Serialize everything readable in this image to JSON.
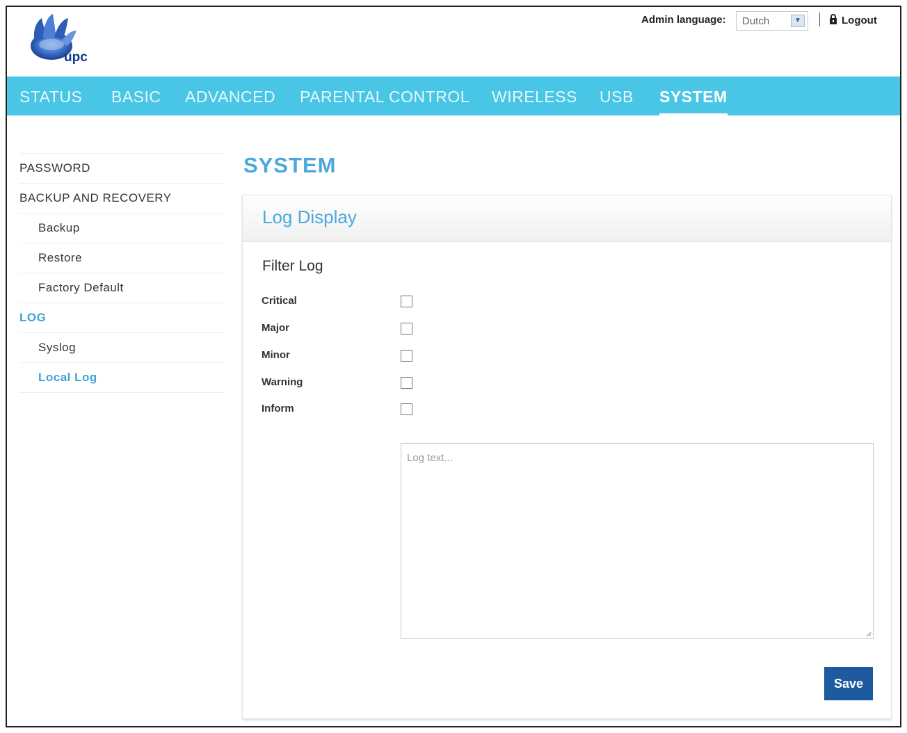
{
  "header": {
    "logo_text": "upc",
    "admin_language_label": "Admin language:",
    "language_value": "Dutch",
    "logout_label": "Logout"
  },
  "nav": {
    "items": [
      {
        "label": "STATUS",
        "active": false
      },
      {
        "label": "BASIC",
        "active": false
      },
      {
        "label": "ADVANCED",
        "active": false
      },
      {
        "label": "PARENTAL CONTROL",
        "active": false
      },
      {
        "label": "WIRELESS",
        "active": false
      },
      {
        "label": "USB",
        "active": false
      },
      {
        "label": "SYSTEM",
        "active": true
      }
    ]
  },
  "sidebar": {
    "items": [
      {
        "label": "PASSWORD",
        "level": 1,
        "active": false
      },
      {
        "label": "BACKUP AND RECOVERY",
        "level": 1,
        "active": false
      },
      {
        "label": "Backup",
        "level": 2,
        "active": false
      },
      {
        "label": "Restore",
        "level": 2,
        "active": false
      },
      {
        "label": "Factory Default",
        "level": 2,
        "active": false
      },
      {
        "label": "LOG",
        "level": 1,
        "active": true
      },
      {
        "label": "Syslog",
        "level": 2,
        "active": false
      },
      {
        "label": "Local Log",
        "level": 2,
        "active": true
      }
    ]
  },
  "main": {
    "page_title": "SYSTEM",
    "panel_title": "Log Display",
    "filter_title": "Filter Log",
    "filters": [
      {
        "label": "Critical",
        "checked": false
      },
      {
        "label": "Major",
        "checked": false
      },
      {
        "label": "Minor",
        "checked": false
      },
      {
        "label": "Warning",
        "checked": false
      },
      {
        "label": "Inform",
        "checked": false
      }
    ],
    "log_placeholder": "Log text...",
    "save_label": "Save"
  },
  "colors": {
    "nav_bg": "#49c6e5",
    "accent": "#4aa9dc",
    "save_button": "#1e5aa0"
  }
}
